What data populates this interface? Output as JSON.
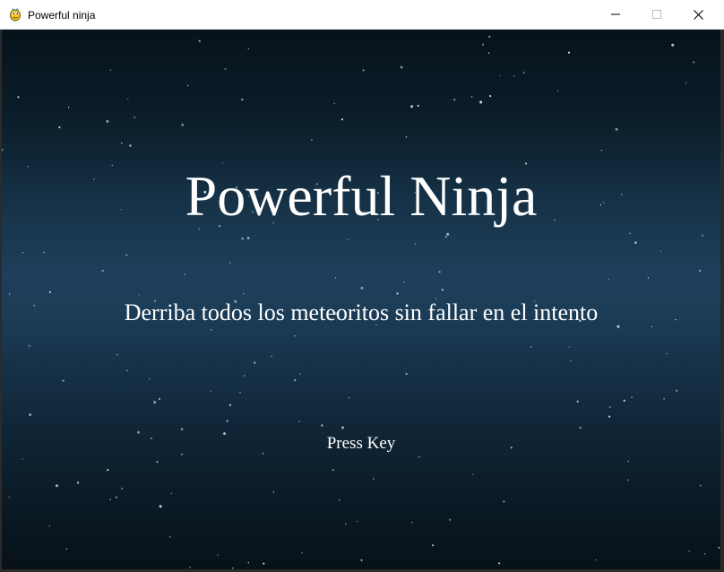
{
  "window": {
    "title": "Powerful ninja",
    "icon": "pygame-snake-icon",
    "controls": {
      "minimize_icon": "minimize-icon",
      "maximize_icon": "maximize-icon",
      "close_icon": "close-icon"
    }
  },
  "game": {
    "title": "Powerful Ninja",
    "subtitle": "Derriba todos los meteoritos sin fallar en el intento",
    "prompt": "Press Key"
  },
  "colors": {
    "text": "#ffffff",
    "sky_top": "#07121a",
    "sky_mid": "#1d3f5b",
    "star": "#cfe0ea"
  }
}
